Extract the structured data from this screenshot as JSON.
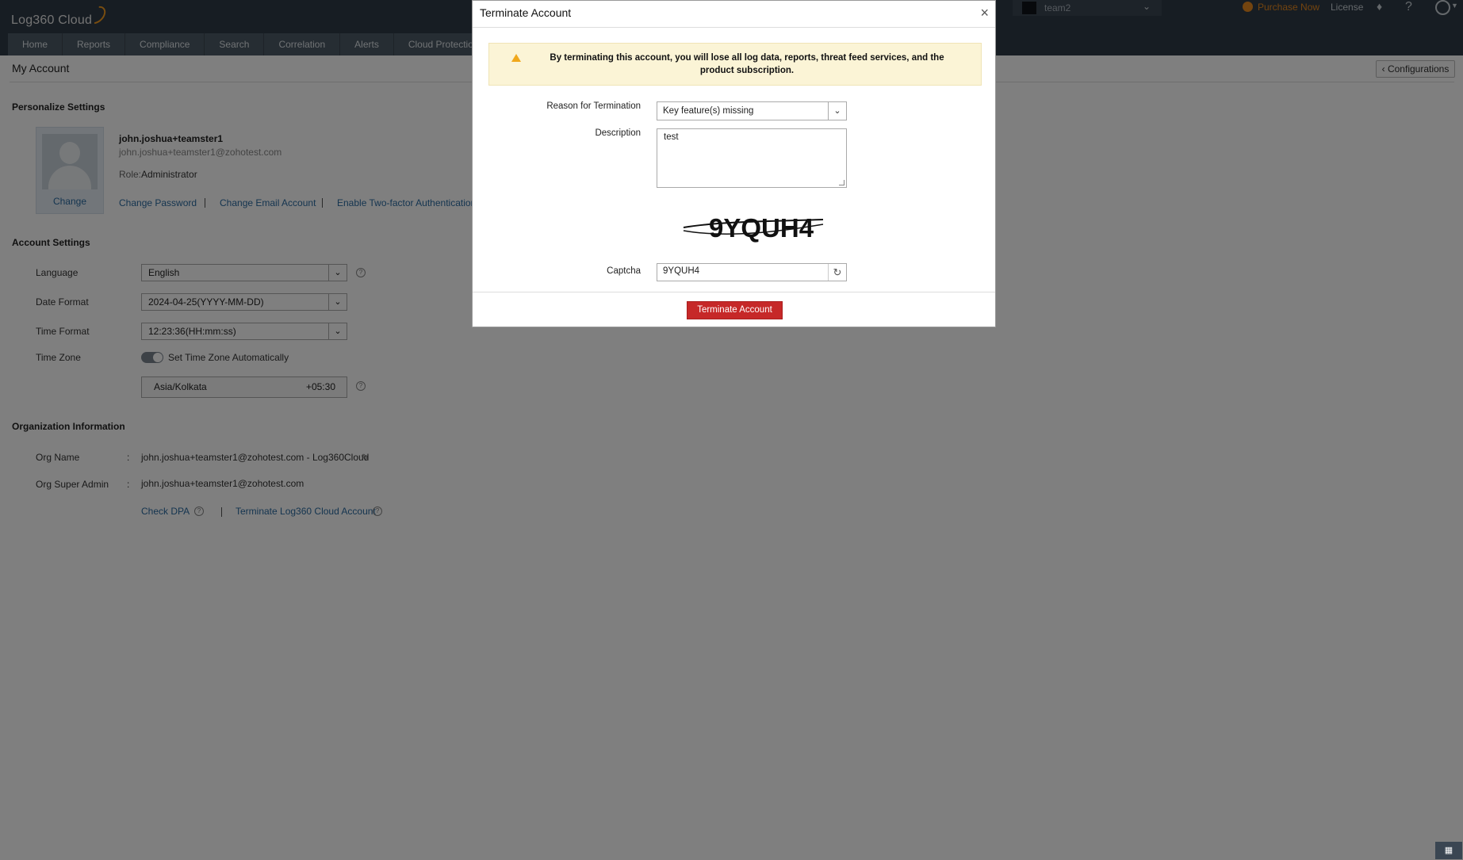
{
  "app": {
    "logo": "Log360 Cloud"
  },
  "header": {
    "team": "team2",
    "purchase": "Purchase Now",
    "license": "License"
  },
  "nav": [
    "Home",
    "Reports",
    "Compliance",
    "Search",
    "Correlation",
    "Alerts",
    "Cloud Protection"
  ],
  "page": {
    "title": "My Account",
    "configurations": "Configurations"
  },
  "personalize": {
    "heading": "Personalize Settings",
    "change_photo": "Change",
    "username": "john.joshua+teamster1",
    "email": "john.joshua+teamster1@zohotest.com",
    "role_label": "Role:",
    "role": "Administrator",
    "links": [
      "Change Password",
      "Change Email Account",
      "Enable Two-factor Authentication"
    ]
  },
  "account": {
    "heading": "Account Settings",
    "language_label": "Language",
    "language": "English",
    "date_label": "Date Format",
    "date": "2024-04-25(YYYY-MM-DD)",
    "time_label": "Time Format",
    "time": "12:23:36(HH:mm:ss)",
    "tz_label": "Time Zone",
    "tz_auto": "Set Time Zone Automatically",
    "tz_name": "Asia/Kolkata",
    "tz_offset": "+05:30"
  },
  "org": {
    "heading": "Organization Information",
    "name_label": "Org Name",
    "name": "john.joshua+teamster1@zohotest.com - Log360Cloud",
    "admin_label": "Org Super Admin",
    "admin": "john.joshua+teamster1@zohotest.com",
    "colon": ":",
    "check_dpa": "Check DPA",
    "terminate_link": "Terminate Log360 Cloud Account"
  },
  "modal": {
    "title": "Terminate Account",
    "close": "×",
    "warning": "By terminating this account, you will lose all log data, reports, threat feed services, and the product subscription.",
    "reason_label": "Reason for Termination",
    "reason": "Key feature(s) missing",
    "description_label": "Description",
    "description": "test",
    "captcha_image_text": "9YQUH4",
    "captcha_label": "Captcha",
    "captcha_value": "9YQUH4",
    "submit": "Terminate Account"
  }
}
